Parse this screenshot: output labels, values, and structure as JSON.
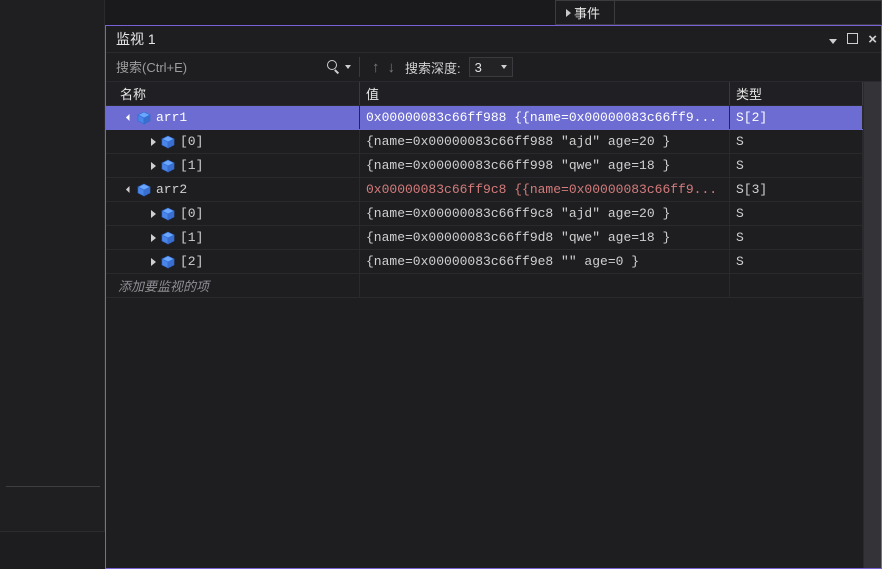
{
  "events_tab_label": "事件",
  "panel_title": "监视 1",
  "toolbar": {
    "search_placeholder": "搜索(Ctrl+E)",
    "depth_label": "搜索深度:",
    "depth_value": "3"
  },
  "columns": {
    "name": "名称",
    "value": "值",
    "type": "类型"
  },
  "rows": [
    {
      "level": 1,
      "expanded": true,
      "selected": true,
      "name": "arr1",
      "value": "0x00000083c66ff988 {{name=0x00000083c66ff9...",
      "type": "S[2]",
      "value_changed": false
    },
    {
      "level": 2,
      "expanded": false,
      "selected": false,
      "name": "[0]",
      "value": "{name=0x00000083c66ff988 \"ajd\" age=20 }",
      "type": "S",
      "value_changed": false
    },
    {
      "level": 2,
      "expanded": false,
      "selected": false,
      "name": "[1]",
      "value": "{name=0x00000083c66ff998 \"qwe\" age=18 }",
      "type": "S",
      "value_changed": false
    },
    {
      "level": 1,
      "expanded": true,
      "selected": false,
      "name": "arr2",
      "value": "0x00000083c66ff9c8 {{name=0x00000083c66ff9...",
      "type": "S[3]",
      "value_changed": true
    },
    {
      "level": 2,
      "expanded": false,
      "selected": false,
      "name": "[0]",
      "value": "{name=0x00000083c66ff9c8 \"ajd\" age=20 }",
      "type": "S",
      "value_changed": false
    },
    {
      "level": 2,
      "expanded": false,
      "selected": false,
      "name": "[1]",
      "value": "{name=0x00000083c66ff9d8 \"qwe\" age=18 }",
      "type": "S",
      "value_changed": false
    },
    {
      "level": 2,
      "expanded": false,
      "selected": false,
      "name": "[2]",
      "value": "{name=0x00000083c66ff9e8 \"\" age=0 }",
      "type": "S",
      "value_changed": false
    }
  ],
  "add_item_label": "添加要监视的项"
}
